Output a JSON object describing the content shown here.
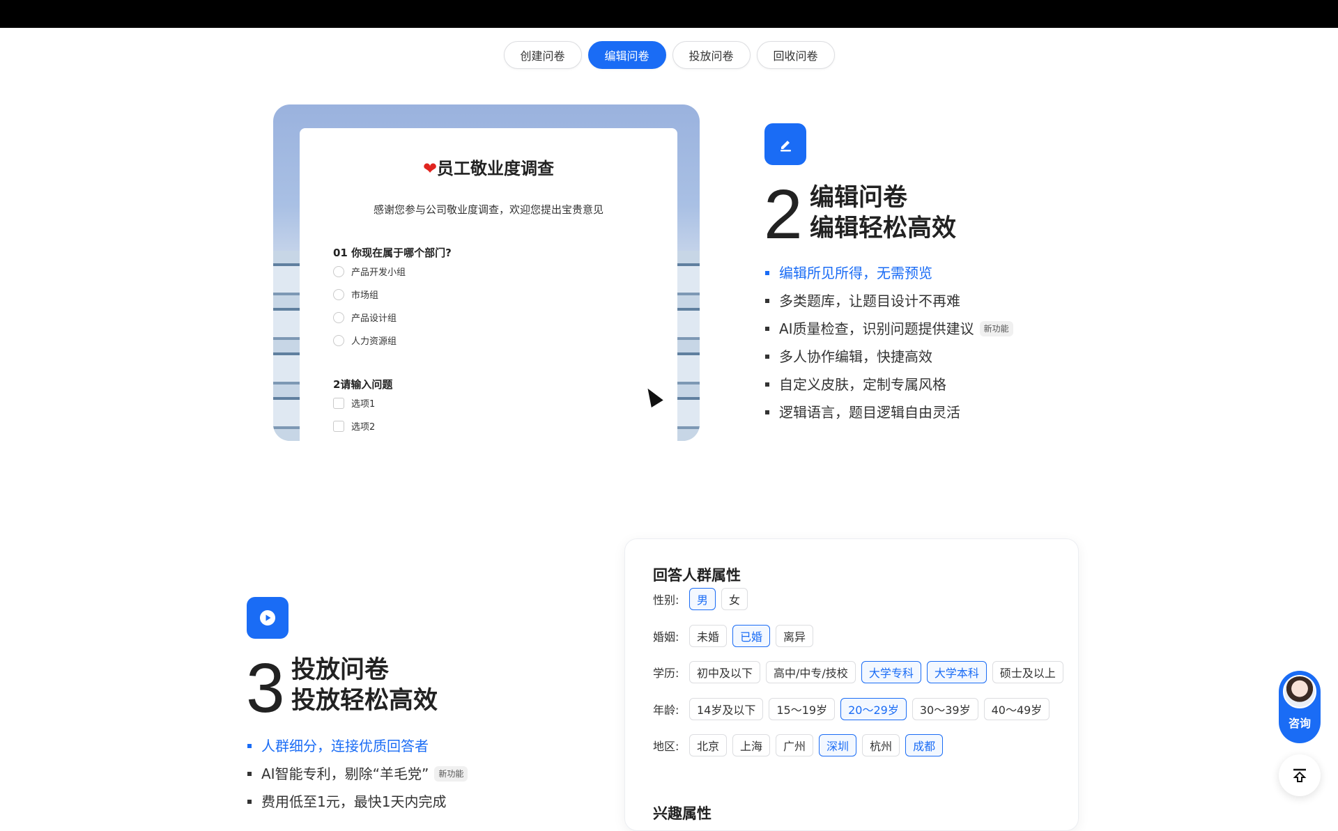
{
  "tabs": [
    {
      "label": "创建问卷",
      "active": false
    },
    {
      "label": "编辑问卷",
      "active": true
    },
    {
      "label": "投放问卷",
      "active": false
    },
    {
      "label": "回收问卷",
      "active": false
    }
  ],
  "preview": {
    "title": "员工敬业度调查",
    "title_icon": "❤️",
    "subtitle": "感谢您参与公司敬业度调查，欢迎您提出宝贵意见",
    "q1": {
      "label": "01  你现在属于哪个部门?",
      "options": [
        "产品开发小组",
        "市场组",
        "产品设计组",
        "人力资源组"
      ]
    },
    "q2": {
      "label": "2请输入问题",
      "options": [
        "选项1",
        "选项2"
      ]
    }
  },
  "feature_edit": {
    "icon": "edit-pen-icon",
    "number": "2",
    "heading_line1": "编辑问卷",
    "heading_line2": "编辑轻松高效",
    "items": [
      {
        "text": "编辑所见所得，无需预览",
        "highlight": true
      },
      {
        "text": "多类题库，让题目设计不再难"
      },
      {
        "text": "AI质量检查，识别问题提供建议",
        "badge": "新功能"
      },
      {
        "text": "多人协作编辑，快捷高效"
      },
      {
        "text": "自定义皮肤，定制专属风格"
      },
      {
        "text": "逻辑语言，题目逻辑自由灵活"
      }
    ]
  },
  "feature_publish": {
    "icon": "play-icon",
    "number": "3",
    "heading_line1": "投放问卷",
    "heading_line2": "投放轻松高效",
    "items": [
      {
        "text": "人群细分，连接优质回答者",
        "highlight": true
      },
      {
        "text": "AI智能专利，剔除“羊毛党”",
        "badge": "新功能"
      },
      {
        "text": "费用低至1元，最快1天内完成"
      }
    ]
  },
  "attributes": {
    "title": "回答人群属性",
    "rows": [
      {
        "label": "性别:",
        "chips": [
          {
            "t": "男",
            "sel": true
          },
          {
            "t": "女"
          }
        ]
      },
      {
        "label": "婚姻:",
        "chips": [
          {
            "t": "未婚"
          },
          {
            "t": "已婚",
            "sel": true
          },
          {
            "t": "离异"
          }
        ]
      },
      {
        "label": "学历:",
        "chips": [
          {
            "t": "初中及以下"
          },
          {
            "t": "高中/中专/技校"
          },
          {
            "t": "大学专科",
            "sel": true
          },
          {
            "t": "大学本科",
            "sel": true
          },
          {
            "t": "硕士及以上"
          }
        ]
      },
      {
        "label": "年龄:",
        "chips": [
          {
            "t": "14岁及以下"
          },
          {
            "t": "15～19岁"
          },
          {
            "t": "20～29岁",
            "sel": true
          },
          {
            "t": "30～39岁"
          },
          {
            "t": "40～49岁"
          }
        ]
      },
      {
        "label": "地区:",
        "chips": [
          {
            "t": "北京"
          },
          {
            "t": "上海"
          },
          {
            "t": "广州"
          },
          {
            "t": "深圳",
            "sel": true
          },
          {
            "t": "杭州"
          },
          {
            "t": "成都",
            "sel": true
          }
        ]
      }
    ],
    "next_title": "兴趣属性"
  },
  "consult": {
    "label": "咨询",
    "avatar": "avatar"
  },
  "back_to_top": {
    "icon": "back-to-top-icon"
  },
  "colors": {
    "accent": "#1a6cf5"
  }
}
